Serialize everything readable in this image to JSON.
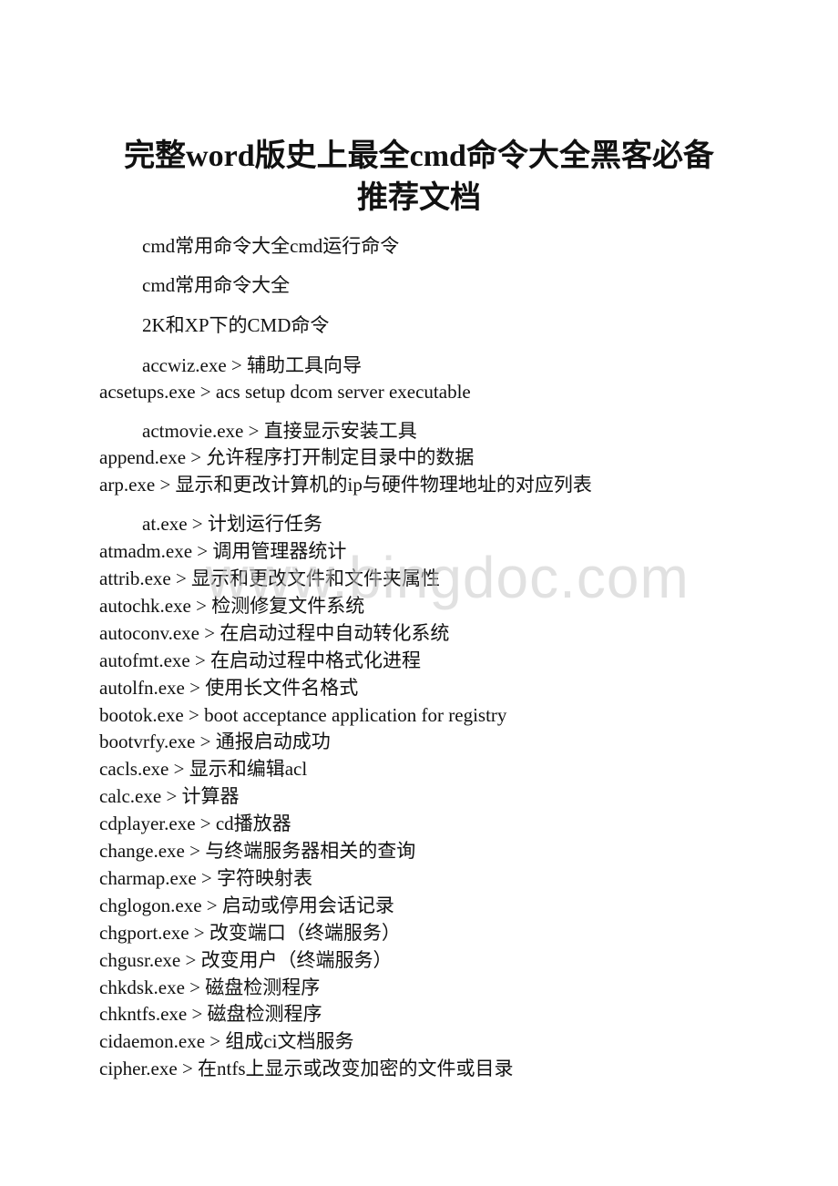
{
  "document": {
    "title_line1": "完整word版史上最全cmd命令大全黑客必备",
    "title_line2": "推荐文档",
    "watermark": "www.bingdoc.com",
    "lines": [
      "cmd常用命令大全cmd运行命令",
      "cmd常用命令大全",
      "2K和XP下的CMD命令",
      "accwiz.exe > 辅助工具向导",
      "acsetups.exe > acs setup dcom server executable",
      "actmovie.exe > 直接显示安装工具",
      "append.exe > 允许程序打开制定目录中的数据",
      "arp.exe > 显示和更改计算机的ip与硬件物理地址的对应列表",
      "at.exe > 计划运行任务",
      "atmadm.exe > 调用管理器统计",
      "attrib.exe > 显示和更改文件和文件夹属性",
      "autochk.exe > 检测修复文件系统",
      "autoconv.exe > 在启动过程中自动转化系统",
      "autofmt.exe > 在启动过程中格式化进程",
      "autolfn.exe > 使用长文件名格式",
      "bootok.exe > boot acceptance application for registry",
      "bootvrfy.exe > 通报启动成功",
      "cacls.exe > 显示和编辑acl",
      "calc.exe > 计算器",
      "cdplayer.exe > cd播放器",
      "change.exe > 与终端服务器相关的查询",
      "charmap.exe > 字符映射表",
      "chglogon.exe > 启动或停用会话记录",
      "chgport.exe > 改变端口（终端服务）",
      "chgusr.exe > 改变用户（终端服务）",
      "chkdsk.exe > 磁盘检测程序",
      "chkntfs.exe > 磁盘检测程序",
      "cidaemon.exe > 组成ci文档服务",
      "cipher.exe > 在ntfs上显示或改变加密的文件或目录"
    ]
  }
}
